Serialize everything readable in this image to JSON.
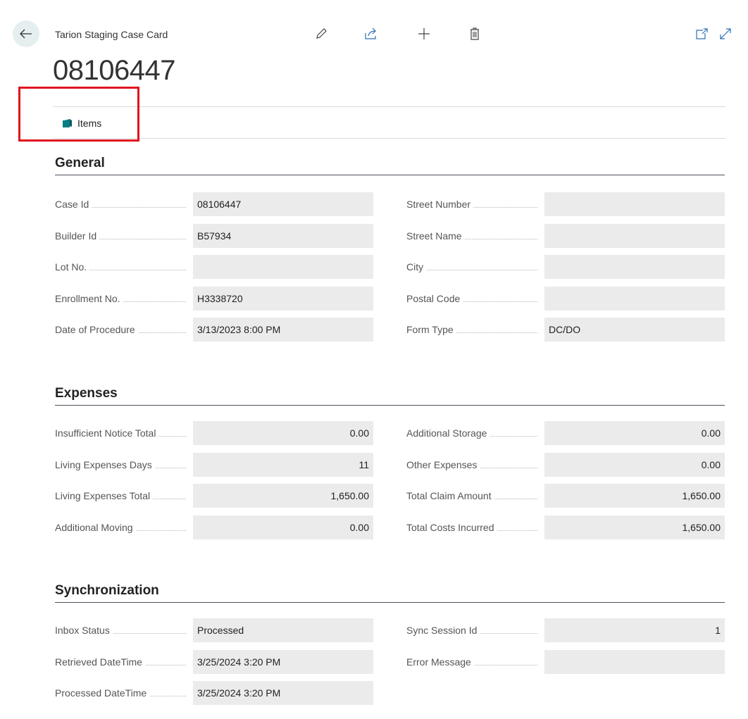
{
  "header": {
    "breadcrumb": "Tarion Staging Case Card",
    "record_title": "08106447",
    "toolbar_icons": [
      "edit-icon",
      "share-icon",
      "new-icon",
      "delete-icon"
    ],
    "window_icons": [
      "open-new-window-icon",
      "expand-icon"
    ]
  },
  "actions": {
    "items_label": "Items"
  },
  "sections": {
    "general": {
      "title": "General",
      "left": [
        {
          "label": "Case Id",
          "value": "08106447"
        },
        {
          "label": "Builder Id",
          "value": "B57934"
        },
        {
          "label": "Lot No.",
          "value": ""
        },
        {
          "label": "Enrollment No.",
          "value": "H3338720"
        },
        {
          "label": "Date of Procedure",
          "value": "3/13/2023 8:00 PM"
        }
      ],
      "right": [
        {
          "label": "Street Number",
          "value": ""
        },
        {
          "label": "Street Name",
          "value": ""
        },
        {
          "label": "City",
          "value": ""
        },
        {
          "label": "Postal Code",
          "value": ""
        },
        {
          "label": "Form Type",
          "value": "DC/DO"
        }
      ]
    },
    "expenses": {
      "title": "Expenses",
      "left": [
        {
          "label": "Insufficient Notice Total",
          "value": "0.00"
        },
        {
          "label": "Living Expenses Days",
          "value": "11"
        },
        {
          "label": "Living Expenses Total",
          "value": "1,650.00"
        },
        {
          "label": "Additional Moving",
          "value": "0.00"
        }
      ],
      "right": [
        {
          "label": "Additional Storage",
          "value": "0.00"
        },
        {
          "label": "Other Expenses",
          "value": "0.00"
        },
        {
          "label": "Total Claim Amount",
          "value": "1,650.00"
        },
        {
          "label": "Total Costs Incurred",
          "value": "1,650.00"
        }
      ]
    },
    "synchronization": {
      "title": "Synchronization",
      "left": [
        {
          "label": "Inbox Status",
          "value": "Processed"
        },
        {
          "label": "Retrieved DateTime",
          "value": "3/25/2024 3:20 PM"
        },
        {
          "label": "Processed DateTime",
          "value": "3/25/2024 3:20 PM"
        }
      ],
      "right": [
        {
          "label": "Sync Session Id",
          "value": "1"
        },
        {
          "label": "Error Message",
          "value": ""
        }
      ]
    }
  },
  "colors": {
    "highlight": "#e0141e",
    "accent": "#0a7c83",
    "field_bg": "#ebebeb"
  }
}
